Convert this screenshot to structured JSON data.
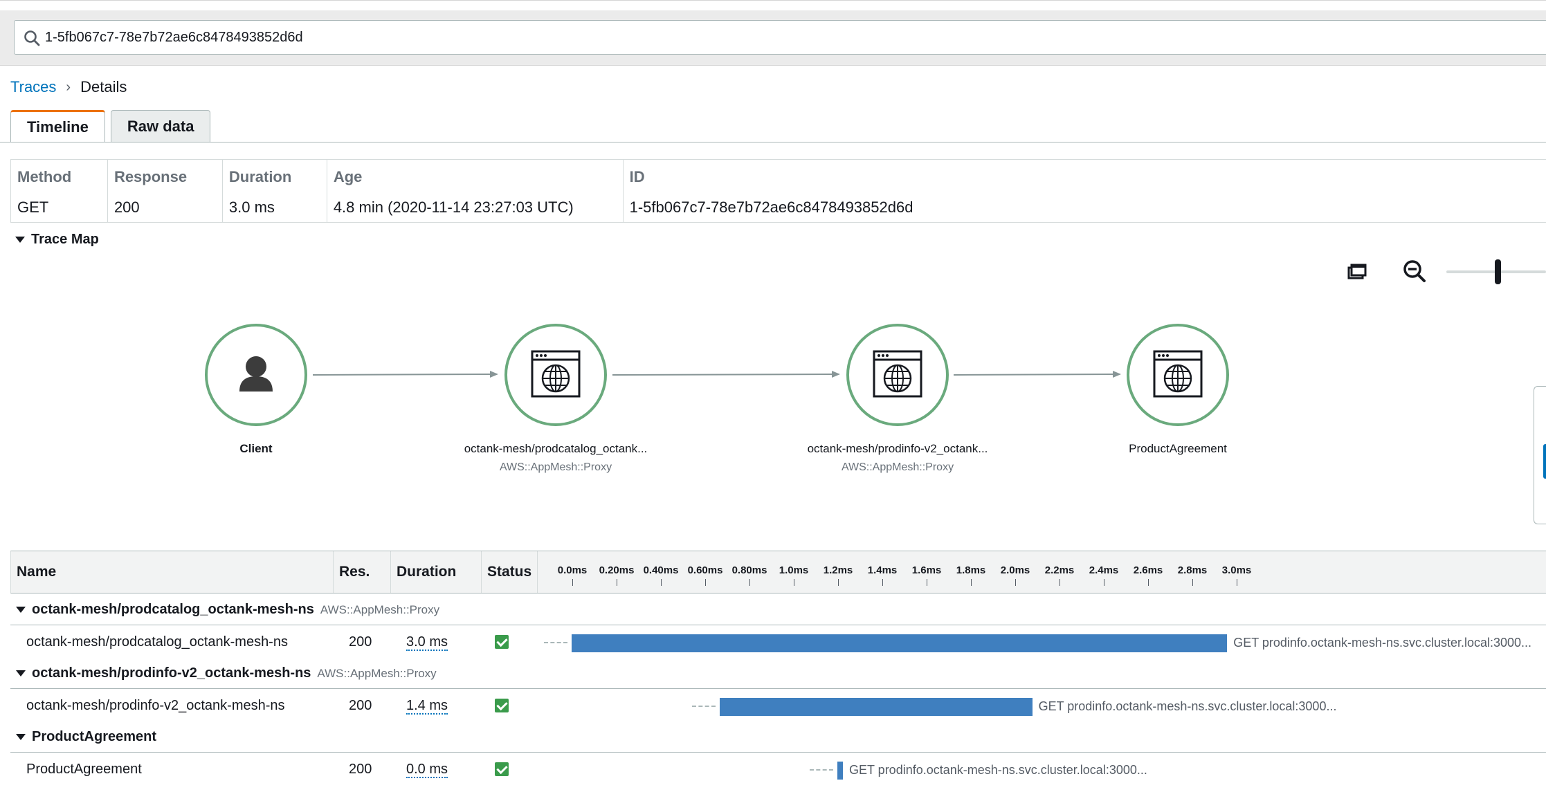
{
  "search": {
    "value": "1-5fb067c7-78e7b72ae6c8478493852d6d"
  },
  "breadcrumb": {
    "root": "Traces",
    "current": "Details"
  },
  "tabs": [
    {
      "label": "Timeline",
      "active": true
    },
    {
      "label": "Raw data",
      "active": false
    }
  ],
  "summary": {
    "headers": [
      "Method",
      "Response",
      "Duration",
      "Age",
      "ID"
    ],
    "values": [
      "GET",
      "200",
      "3.0 ms",
      "4.8 min (2020-11-14 23:27:03 UTC)",
      "1-5fb067c7-78e7b72ae6c8478493852d6d"
    ]
  },
  "trace_map": {
    "title": "Trace Map",
    "nodes": [
      {
        "label": "Client",
        "sublabel": "",
        "icon": "user-icon"
      },
      {
        "label": "octank-mesh/prodcatalog_octank...",
        "sublabel": "AWS::AppMesh::Proxy",
        "icon": "web-globe-icon"
      },
      {
        "label": "octank-mesh/prodinfo-v2_octank...",
        "sublabel": "AWS::AppMesh::Proxy",
        "icon": "web-globe-icon"
      },
      {
        "label": "ProductAgreement",
        "sublabel": "",
        "icon": "web-globe-icon"
      }
    ],
    "node_color": "#6aaa7d"
  },
  "timeline": {
    "headers": {
      "name": "Name",
      "res": "Res.",
      "duration": "Duration",
      "status": "Status"
    },
    "axis_ticks": [
      "0.0ms",
      "0.20ms",
      "0.40ms",
      "0.60ms",
      "0.80ms",
      "1.0ms",
      "1.2ms",
      "1.4ms",
      "1.6ms",
      "1.8ms",
      "2.0ms",
      "2.2ms",
      "2.4ms",
      "2.6ms",
      "2.8ms",
      "3.0ms"
    ],
    "groups": [
      {
        "name": "octank-mesh/prodcatalog_octank-mesh-ns",
        "type": "AWS::AppMesh::Proxy",
        "segment": {
          "name": "octank-mesh/prodcatalog_octank-mesh-ns",
          "res": "200",
          "duration": "3.0 ms",
          "start_ms": 0.0,
          "end_ms": 2.96,
          "label": "GET prodinfo.octank-mesh-ns.svc.cluster.local:3000..."
        }
      },
      {
        "name": "octank-mesh/prodinfo-v2_octank-mesh-ns",
        "type": "AWS::AppMesh::Proxy",
        "segment": {
          "name": "octank-mesh/prodinfo-v2_octank-mesh-ns",
          "res": "200",
          "duration": "1.4 ms",
          "start_ms": 0.67,
          "end_ms": 2.08,
          "label": "GET prodinfo.octank-mesh-ns.svc.cluster.local:3000..."
        }
      },
      {
        "name": "ProductAgreement",
        "type": "",
        "segment": {
          "name": "ProductAgreement",
          "res": "200",
          "duration": "0.0 ms",
          "start_ms": 1.2,
          "end_ms": 1.22,
          "label": "GET prodinfo.octank-mesh-ns.svc.cluster.local:3000..."
        }
      }
    ],
    "bar_color": "#3f7fbf",
    "status_color": "#3a9b4b"
  }
}
